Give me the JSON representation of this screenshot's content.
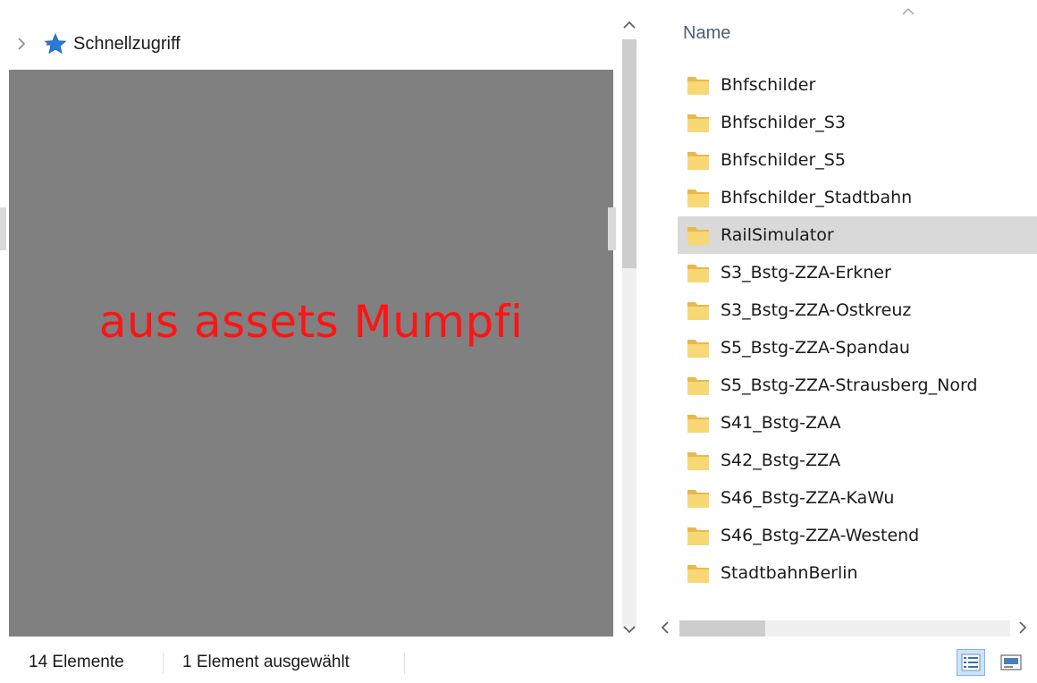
{
  "navigation": {
    "quick_access_label": "Schnellzugriff",
    "expand_icon": "chevron-right-icon",
    "quick_access_icon": "star-icon",
    "redaction_overlay_text": "aus assets Mumpfi"
  },
  "file_list": {
    "column_header": "Name",
    "sort_indicator": "sort-ascending-icon",
    "items": [
      {
        "name": "Bhfschilder",
        "type": "folder",
        "selected": false
      },
      {
        "name": "Bhfschilder_S3",
        "type": "folder",
        "selected": false
      },
      {
        "name": "Bhfschilder_S5",
        "type": "folder",
        "selected": false
      },
      {
        "name": "Bhfschilder_Stadtbahn",
        "type": "folder",
        "selected": false
      },
      {
        "name": "RailSimulator",
        "type": "folder",
        "selected": true
      },
      {
        "name": "S3_Bstg-ZZA-Erkner",
        "type": "folder",
        "selected": false
      },
      {
        "name": "S3_Bstg-ZZA-Ostkreuz",
        "type": "folder",
        "selected": false
      },
      {
        "name": "S5_Bstg-ZZA-Spandau",
        "type": "folder",
        "selected": false
      },
      {
        "name": "S5_Bstg-ZZA-Strausberg_Nord",
        "type": "folder",
        "selected": false
      },
      {
        "name": "S41_Bstg-ZAA",
        "type": "folder",
        "selected": false
      },
      {
        "name": "S42_Bstg-ZZA",
        "type": "folder",
        "selected": false
      },
      {
        "name": "S46_Bstg-ZZA-KaWu",
        "type": "folder",
        "selected": false
      },
      {
        "name": "S46_Bstg-ZZA-Westend",
        "type": "folder",
        "selected": false
      },
      {
        "name": "StadtbahnBerlin",
        "type": "folder",
        "selected": false
      }
    ]
  },
  "status_bar": {
    "item_count": "14 Elemente",
    "selection": "1 Element ausgewählt",
    "view_details_icon": "details-view-icon",
    "view_tiles_icon": "large-icons-view-icon",
    "active_view": "details"
  },
  "colors": {
    "redaction_fill": "#808080",
    "redaction_text": "#ff1414",
    "selected_row": "#d9d9d9",
    "folder_yellow": "#f8d775",
    "header_text": "#4c607a",
    "active_view_bg": "#cce4f7"
  }
}
